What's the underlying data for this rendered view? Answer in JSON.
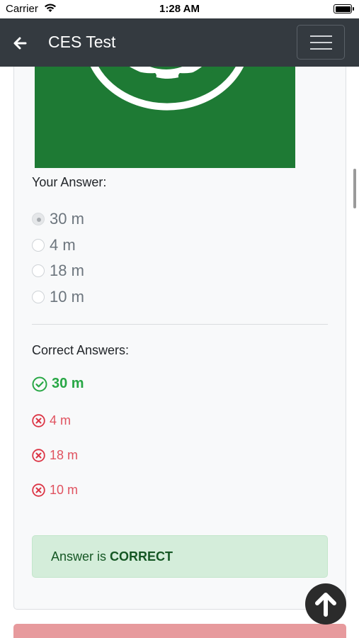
{
  "status_bar": {
    "carrier": "Carrier",
    "time": "1:28 AM"
  },
  "navbar": {
    "title": "CES Test",
    "back_icon": "arrow-left-icon",
    "menu_icon": "hamburger-menu-icon"
  },
  "question": {
    "image": {
      "description_icon": "road-sign-image",
      "background": "#1e7a34"
    },
    "your_answer_label": "Your Answer:",
    "options": [
      {
        "label": "30 m",
        "selected": true
      },
      {
        "label": "4 m",
        "selected": false
      },
      {
        "label": "18 m",
        "selected": false
      },
      {
        "label": "10 m",
        "selected": false
      }
    ],
    "correct_answers_label": "Correct Answers:",
    "answers": [
      {
        "label": "30 m",
        "correct": true
      },
      {
        "label": "4 m",
        "correct": false
      },
      {
        "label": "18 m",
        "correct": false
      },
      {
        "label": "10 m",
        "correct": false
      }
    ],
    "result_prefix": "Answer is",
    "result_value": "CORRECT"
  },
  "colors": {
    "navbar": "#343a40",
    "correct": "#28a745",
    "incorrect": "#dc3545",
    "alert_bg": "#d4edda"
  }
}
